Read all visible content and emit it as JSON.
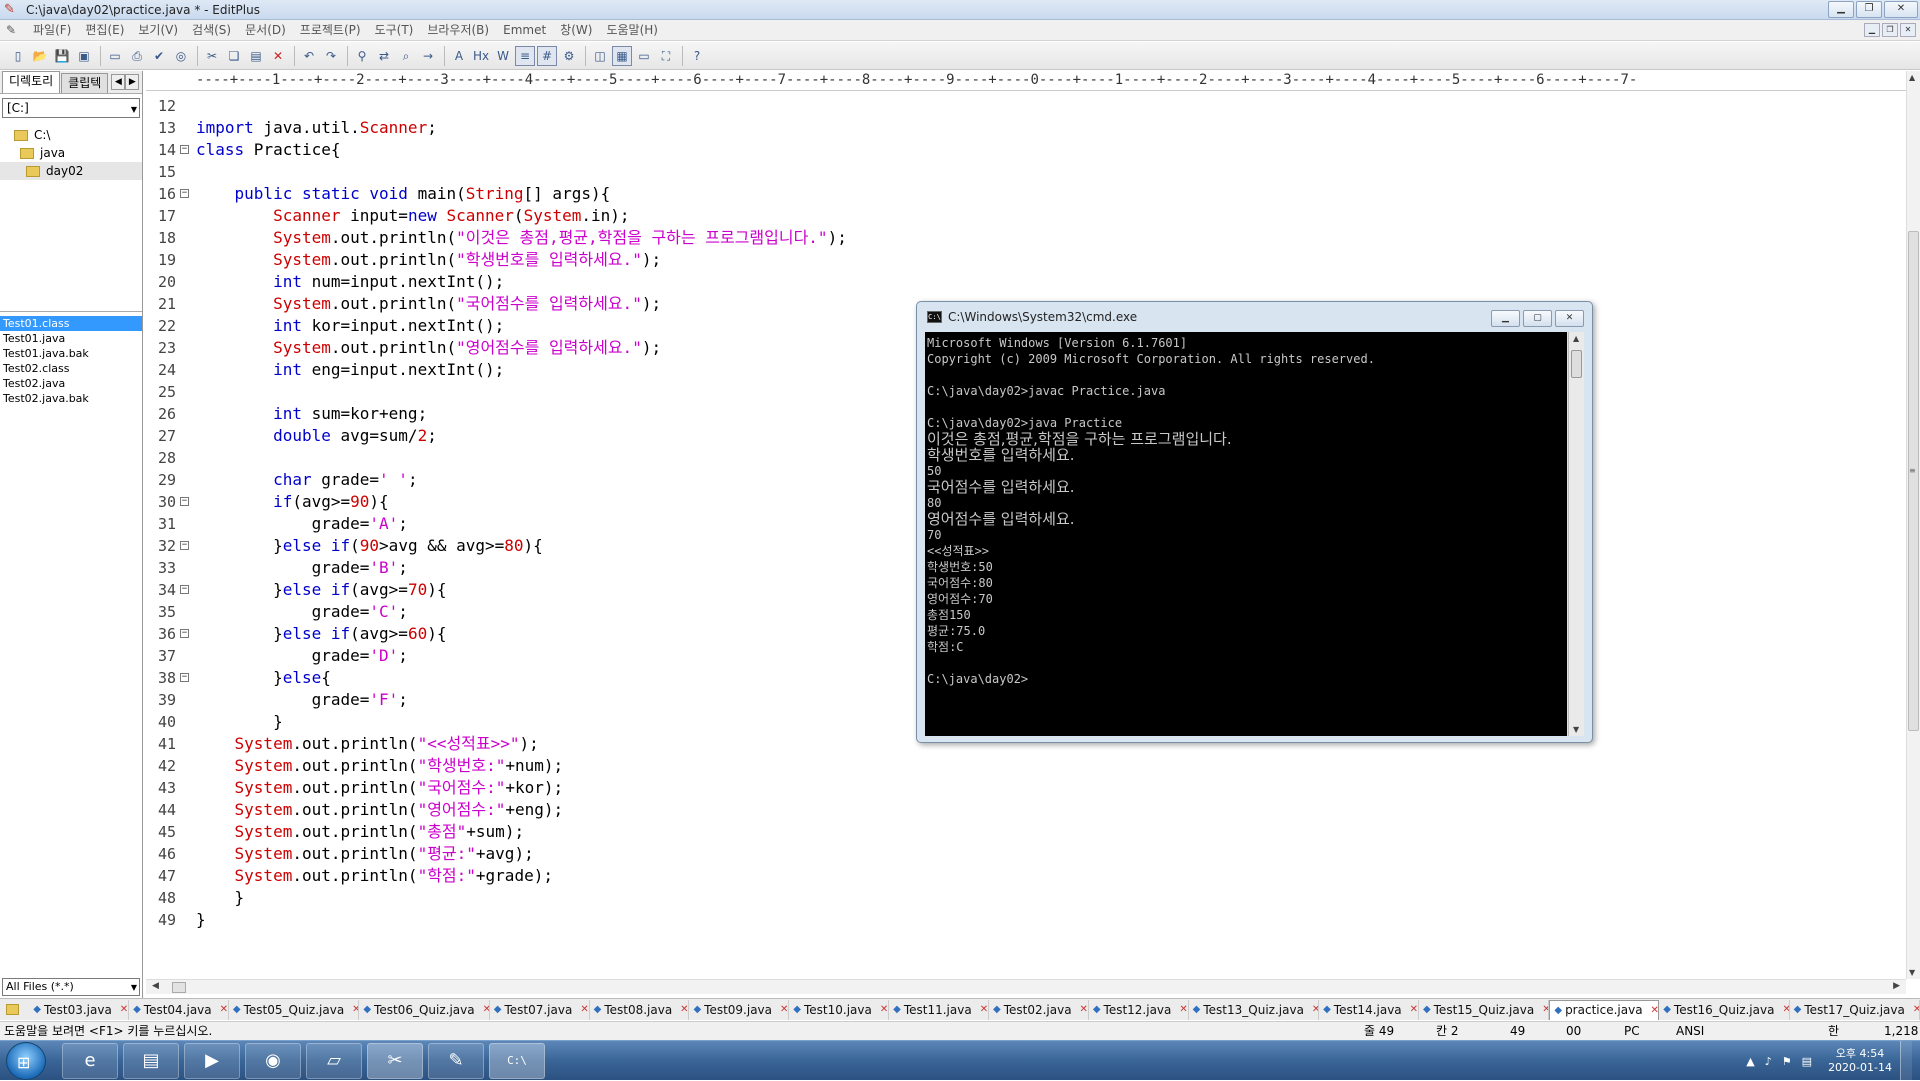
{
  "window": {
    "title": "C:\\java\\day02\\practice.java * - EditPlus"
  },
  "menu": [
    "파일(F)",
    "편집(E)",
    "보기(V)",
    "검색(S)",
    "문서(D)",
    "프로젝트(P)",
    "도구(T)",
    "브라우저(B)",
    "Emmet",
    "창(W)",
    "도움말(H)"
  ],
  "toolbar_icons": [
    "new-file-icon",
    "open-icon",
    "save-icon",
    "save-all-icon",
    "print-preview-icon",
    "print-icon",
    "spell-check-icon",
    "browser-icon",
    "cut-icon",
    "copy-icon",
    "paste-icon",
    "delete-icon",
    "undo-icon",
    "redo-icon",
    "find-icon",
    "replace-icon",
    "find-in-files-icon",
    "goto-icon",
    "font-icon",
    "hex-icon",
    "word-wrap-icon",
    "ruler-icon",
    "line-number-icon",
    "settings-icon",
    "split-icon",
    "directory-icon",
    "output-icon",
    "fullscreen-icon",
    "help-icon"
  ],
  "panel": {
    "tabs": [
      "디렉토리",
      "클립텍"
    ],
    "drive": "[C:]",
    "tree": [
      "C:\\",
      "java",
      "day02"
    ],
    "files": [
      "Test01.class",
      "Test01.java",
      "Test01.java.bak",
      "Test02.class",
      "Test02.java",
      "Test02.java.bak"
    ],
    "filter": "All Files (*.*)"
  },
  "ruler": "----+----1----+----2----+----3----+----4----+----5----+----6----+----7----+----8----+----9----+----0----+----1----+----2----+----3----+----4----+----5----+----6----+----7-",
  "code": [
    {
      "n": "12",
      "t": ""
    },
    {
      "n": "13",
      "t": "import java.util.Scanner;"
    },
    {
      "n": "14",
      "t": "class Practice{",
      "fold": true
    },
    {
      "n": "15",
      "t": ""
    },
    {
      "n": "16",
      "t": "    public static void main(String[] args){",
      "fold": true
    },
    {
      "n": "17",
      "t": "        Scanner input=new Scanner(System.in);"
    },
    {
      "n": "18",
      "t": "        System.out.println(\"이것은 총점,평균,학점을 구하는 프로그램입니다.\");"
    },
    {
      "n": "19",
      "t": "        System.out.println(\"학생번호를 입력하세요.\");"
    },
    {
      "n": "20",
      "t": "        int num=input.nextInt();"
    },
    {
      "n": "21",
      "t": "        System.out.println(\"국어점수를 입력하세요.\");"
    },
    {
      "n": "22",
      "t": "        int kor=input.nextInt();"
    },
    {
      "n": "23",
      "t": "        System.out.println(\"영어점수를 입력하세요.\");"
    },
    {
      "n": "24",
      "t": "        int eng=input.nextInt();"
    },
    {
      "n": "25",
      "t": ""
    },
    {
      "n": "26",
      "t": "        int sum=kor+eng;"
    },
    {
      "n": "27",
      "t": "        double avg=sum/2;"
    },
    {
      "n": "28",
      "t": ""
    },
    {
      "n": "29",
      "t": "        char grade=' ';"
    },
    {
      "n": "30",
      "t": "        if(avg>=90){",
      "fold": true
    },
    {
      "n": "31",
      "t": "            grade='A';"
    },
    {
      "n": "32",
      "t": "        }else if(90>avg && avg>=80){",
      "fold": true
    },
    {
      "n": "33",
      "t": "            grade='B';"
    },
    {
      "n": "34",
      "t": "        }else if(avg>=70){",
      "fold": true
    },
    {
      "n": "35",
      "t": "            grade='C';"
    },
    {
      "n": "36",
      "t": "        }else if(avg>=60){",
      "fold": true
    },
    {
      "n": "37",
      "t": "            grade='D';"
    },
    {
      "n": "38",
      "t": "        }else{",
      "fold": true
    },
    {
      "n": "39",
      "t": "            grade='F';"
    },
    {
      "n": "40",
      "t": "        }"
    },
    {
      "n": "41",
      "t": "    System.out.println(\"<<성적표>>\");"
    },
    {
      "n": "42",
      "t": "    System.out.println(\"학생번호:\"+num);"
    },
    {
      "n": "43",
      "t": "    System.out.println(\"국어점수:\"+kor);"
    },
    {
      "n": "44",
      "t": "    System.out.println(\"영어점수:\"+eng);"
    },
    {
      "n": "45",
      "t": "    System.out.println(\"총점\"+sum);"
    },
    {
      "n": "46",
      "t": "    System.out.println(\"평균:\"+avg);"
    },
    {
      "n": "47",
      "t": "    System.out.println(\"학점:\"+grade);"
    },
    {
      "n": "48",
      "t": "    }"
    },
    {
      "n": "49",
      "t": "}"
    }
  ],
  "doc_tabs": [
    "Test03.java",
    "Test04.java",
    "Test05_Quiz.java",
    "Test06_Quiz.java",
    "Test07.java",
    "Test08.java",
    "Test09.java",
    "Test10.java",
    "Test11.java",
    "Test02.java",
    "Test12.java",
    "Test13_Quiz.java",
    "Test14.java",
    "Test15_Quiz.java",
    "practice.java",
    "Test16_Quiz.java",
    "Test17_Quiz.java"
  ],
  "active_doc_tab": "practice.java",
  "status": {
    "help": "도움말을 보려면 <F1> 키를 누르십시오.",
    "line": "줄 49",
    "col": "칸 2",
    "lines": "49",
    "code": "00",
    "mode": "PC",
    "encoding": "ANSI",
    "ime": "한",
    "size": "1,218"
  },
  "cmd": {
    "title": "C:\\Windows\\System32\\cmd.exe",
    "lines": [
      {
        "t": "Microsoft Windows [Version 6.1.7601]"
      },
      {
        "t": "Copyright (c) 2009 Microsoft Corporation. All rights reserved."
      },
      {
        "t": ""
      },
      {
        "t": "C:\\java\\day02>javac Practice.java"
      },
      {
        "t": ""
      },
      {
        "t": "C:\\java\\day02>java Practice"
      },
      {
        "t": "이것은 총점,평균,학점을 구하는 프로그램입니다.",
        "k": true
      },
      {
        "t": "학생번호를 입력하세요.",
        "k": true
      },
      {
        "t": "50"
      },
      {
        "t": "국어점수를 입력하세요.",
        "k": true
      },
      {
        "t": "80"
      },
      {
        "t": "영어점수를 입력하세요.",
        "k": true
      },
      {
        "t": "70"
      },
      {
        "t": "<<성적표>>"
      },
      {
        "t": "학생번호:50"
      },
      {
        "t": "국어점수:80"
      },
      {
        "t": "영어점수:70"
      },
      {
        "t": "총점150"
      },
      {
        "t": "평균:75.0"
      },
      {
        "t": "학점:C"
      },
      {
        "t": ""
      },
      {
        "t": "C:\\java\\day02>"
      }
    ]
  },
  "taskbar": {
    "apps": [
      "ie-icon",
      "explorer-icon",
      "media-player-icon",
      "chrome-icon",
      "notepad-icon",
      "snipping-tool-icon",
      "editplus-icon",
      "cmd-icon"
    ],
    "time": "오후 4:54",
    "date": "2020-01-14"
  },
  "colors": {
    "keyword": "#0000cc",
    "class": "#cc0000",
    "string": "#cc00cc",
    "selection": "#3399ff"
  }
}
